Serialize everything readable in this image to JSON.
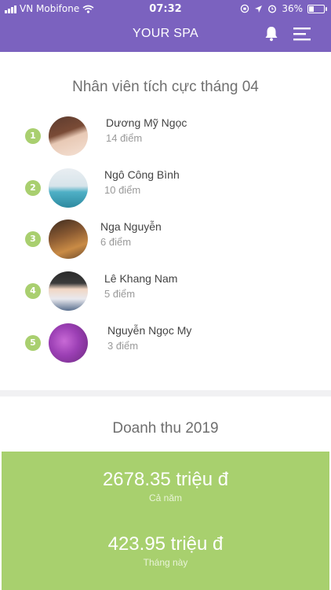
{
  "status_bar": {
    "carrier": "VN Mobifone",
    "time": "07:32",
    "battery": "36%",
    "battery_level": 0.36
  },
  "header": {
    "title": "YOUR SPA",
    "icons": [
      "bell-icon",
      "menu-icon"
    ]
  },
  "top_staff": {
    "title": "Nhân viên tích cực tháng 04",
    "items": [
      {
        "rank": "1",
        "name": "Dương Mỹ Ngọc",
        "points": "14 điểm"
      },
      {
        "rank": "2",
        "name": "Ngô Công Bình",
        "points": "10 điểm"
      },
      {
        "rank": "3",
        "name": "Nga Nguyễn",
        "points": "6 điểm"
      },
      {
        "rank": "4",
        "name": "Lê Khang Nam",
        "points": "5 điểm"
      },
      {
        "rank": "5",
        "name": "Nguyễn Ngọc My",
        "points": "3 điểm"
      }
    ]
  },
  "revenue": {
    "title": "Doanh thu 2019",
    "year_value": "2678.35 triệu đ",
    "year_label": "Cả năm",
    "month_value": "423.95 triệu đ",
    "month_label": "Tháng này"
  },
  "colors": {
    "header": "#7b62bf",
    "rank_badge": "#a9cf6f",
    "revenue_box": "#a8d06e"
  }
}
